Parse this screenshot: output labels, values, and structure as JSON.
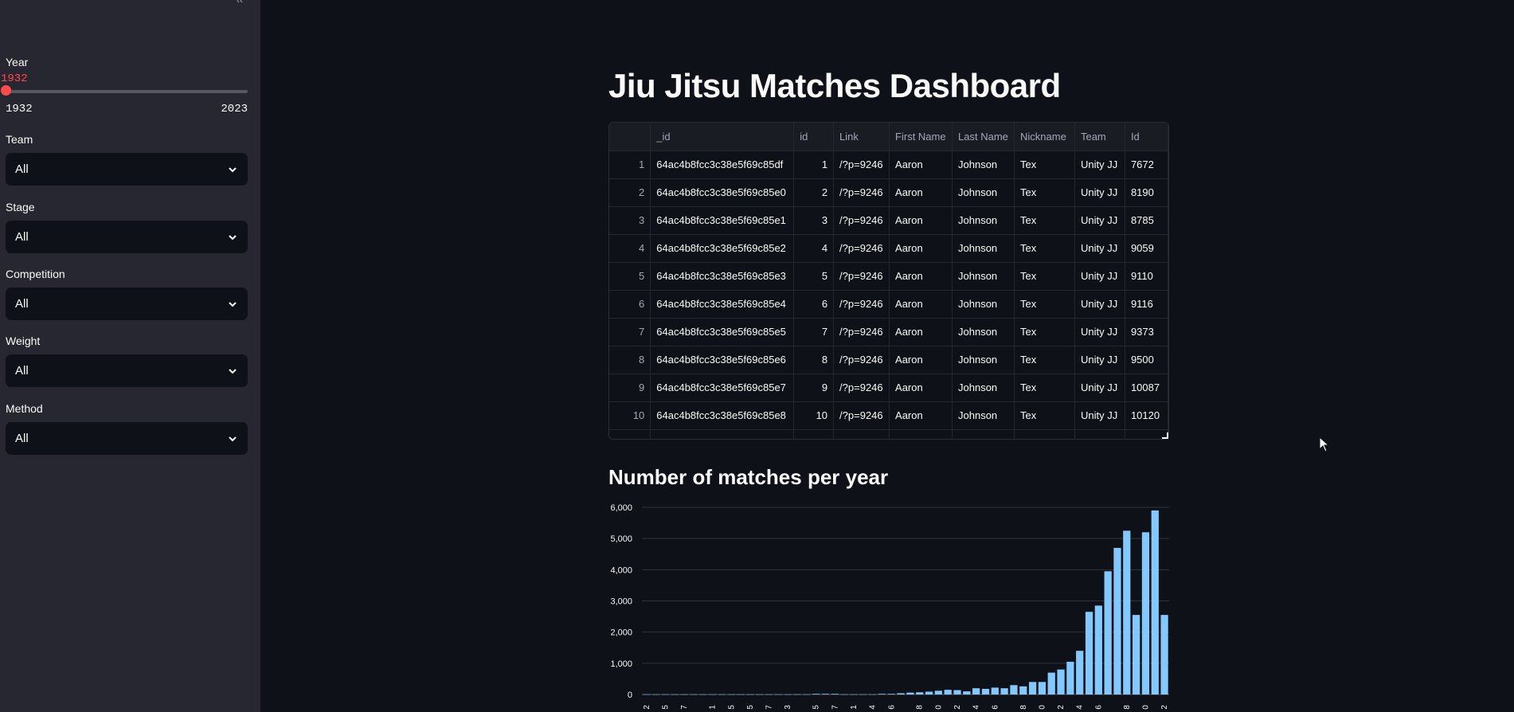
{
  "sidebar": {
    "year": {
      "label": "Year",
      "value": "1932",
      "min": "1932",
      "max": "2023"
    },
    "filters": [
      {
        "label": "Team",
        "value": "All"
      },
      {
        "label": "Stage",
        "value": "All"
      },
      {
        "label": "Competition",
        "value": "All"
      },
      {
        "label": "Weight",
        "value": "All"
      },
      {
        "label": "Method",
        "value": "All"
      }
    ]
  },
  "main": {
    "title": "Jiu Jitsu Matches Dashboard",
    "table": {
      "columns": [
        "",
        "_id",
        "id",
        "Link",
        "First Name",
        "Last Name",
        "Nickname",
        "Team",
        "Id"
      ],
      "rows": [
        [
          "1",
          "64ac4b8fcc3c38e5f69c85df",
          "1",
          "/?p=9246",
          "Aaron",
          "Johnson",
          "Tex",
          "Unity JJ",
          "7672"
        ],
        [
          "2",
          "64ac4b8fcc3c38e5f69c85e0",
          "2",
          "/?p=9246",
          "Aaron",
          "Johnson",
          "Tex",
          "Unity JJ",
          "8190"
        ],
        [
          "3",
          "64ac4b8fcc3c38e5f69c85e1",
          "3",
          "/?p=9246",
          "Aaron",
          "Johnson",
          "Tex",
          "Unity JJ",
          "8785"
        ],
        [
          "4",
          "64ac4b8fcc3c38e5f69c85e2",
          "4",
          "/?p=9246",
          "Aaron",
          "Johnson",
          "Tex",
          "Unity JJ",
          "9059"
        ],
        [
          "5",
          "64ac4b8fcc3c38e5f69c85e3",
          "5",
          "/?p=9246",
          "Aaron",
          "Johnson",
          "Tex",
          "Unity JJ",
          "9110"
        ],
        [
          "6",
          "64ac4b8fcc3c38e5f69c85e4",
          "6",
          "/?p=9246",
          "Aaron",
          "Johnson",
          "Tex",
          "Unity JJ",
          "9116"
        ],
        [
          "7",
          "64ac4b8fcc3c38e5f69c85e5",
          "7",
          "/?p=9246",
          "Aaron",
          "Johnson",
          "Tex",
          "Unity JJ",
          "9373"
        ],
        [
          "8",
          "64ac4b8fcc3c38e5f69c85e6",
          "8",
          "/?p=9246",
          "Aaron",
          "Johnson",
          "Tex",
          "Unity JJ",
          "9500"
        ],
        [
          "9",
          "64ac4b8fcc3c38e5f69c85e7",
          "9",
          "/?p=9246",
          "Aaron",
          "Johnson",
          "Tex",
          "Unity JJ",
          "10087"
        ],
        [
          "10",
          "64ac4b8fcc3c38e5f69c85e8",
          "10",
          "/?p=9246",
          "Aaron",
          "Johnson",
          "Tex",
          "Unity JJ",
          "10120"
        ]
      ]
    },
    "chart_title": "Number of matches per year"
  },
  "colors": {
    "background": "#0e1117",
    "sidebar": "#262730",
    "accent": "#ff4b4b",
    "bar": "#83c9ff"
  },
  "chart_data": {
    "type": "bar",
    "title": "Number of matches per year",
    "xlabel": "",
    "ylabel": "",
    "ylim": [
      0,
      6000
    ],
    "yticks": [
      0,
      1000,
      2000,
      3000,
      4000,
      5000,
      6000
    ],
    "ytick_labels": [
      "0",
      "1,000",
      "2,000",
      "3,000",
      "4,000",
      "5,000",
      "6,000"
    ],
    "xtick_labels": [
      "2",
      "5",
      "7",
      "1",
      "5",
      "5",
      "7",
      "3",
      "5",
      "7",
      "1",
      "4",
      "6",
      "8",
      "0",
      "2",
      "4",
      "6",
      "8",
      "0",
      "2",
      "4",
      "6",
      "8",
      "0",
      "2"
    ],
    "grid": true,
    "values": [
      5,
      5,
      5,
      5,
      5,
      5,
      5,
      5,
      5,
      5,
      5,
      5,
      5,
      5,
      5,
      5,
      5,
      5,
      20,
      20,
      20,
      5,
      5,
      5,
      5,
      20,
      20,
      40,
      60,
      70,
      90,
      120,
      150,
      140,
      100,
      200,
      180,
      220,
      200,
      300,
      260,
      400,
      400,
      700,
      800,
      1050,
      1400,
      2650,
      2850,
      3950,
      4700,
      5250,
      2550,
      5200,
      5900,
      2550
    ]
  }
}
